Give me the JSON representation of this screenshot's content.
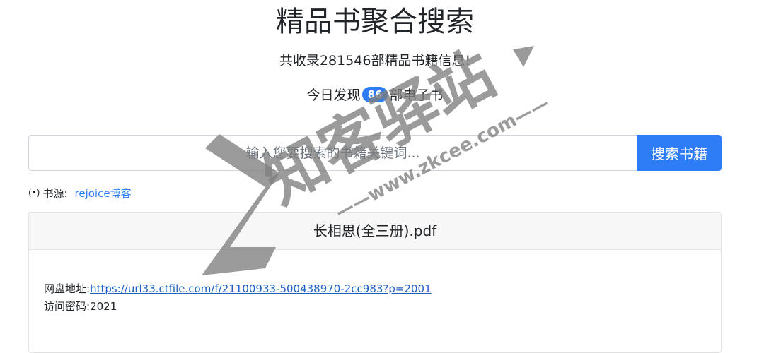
{
  "header": {
    "title": "精品书聚合搜索",
    "subtitle": "共收录281546部精品书籍信息!",
    "today_prefix": "今日发现",
    "today_count": "86",
    "today_suffix": "部电子书"
  },
  "search": {
    "placeholder": "输入您要搜索的书籍关键词...",
    "button_label": "搜索书籍"
  },
  "source": {
    "icon": "radio-icon",
    "label": "书源:",
    "link_text": "rejoice博客"
  },
  "result": {
    "title": "长相思(全三册).pdf",
    "disk_label": "网盘地址:",
    "disk_url": "https://url33.ctfile.com/f/21100933-500438970-2cc983?p=2001",
    "password_label": "访问密码:",
    "password": "2021"
  },
  "watermark": {
    "logo_letter": "Z",
    "brand": "知客驿站",
    "domain": "——www.zkcee.com——"
  },
  "colors": {
    "accent": "#2f7df6",
    "watermark": "#7f7f7f"
  }
}
